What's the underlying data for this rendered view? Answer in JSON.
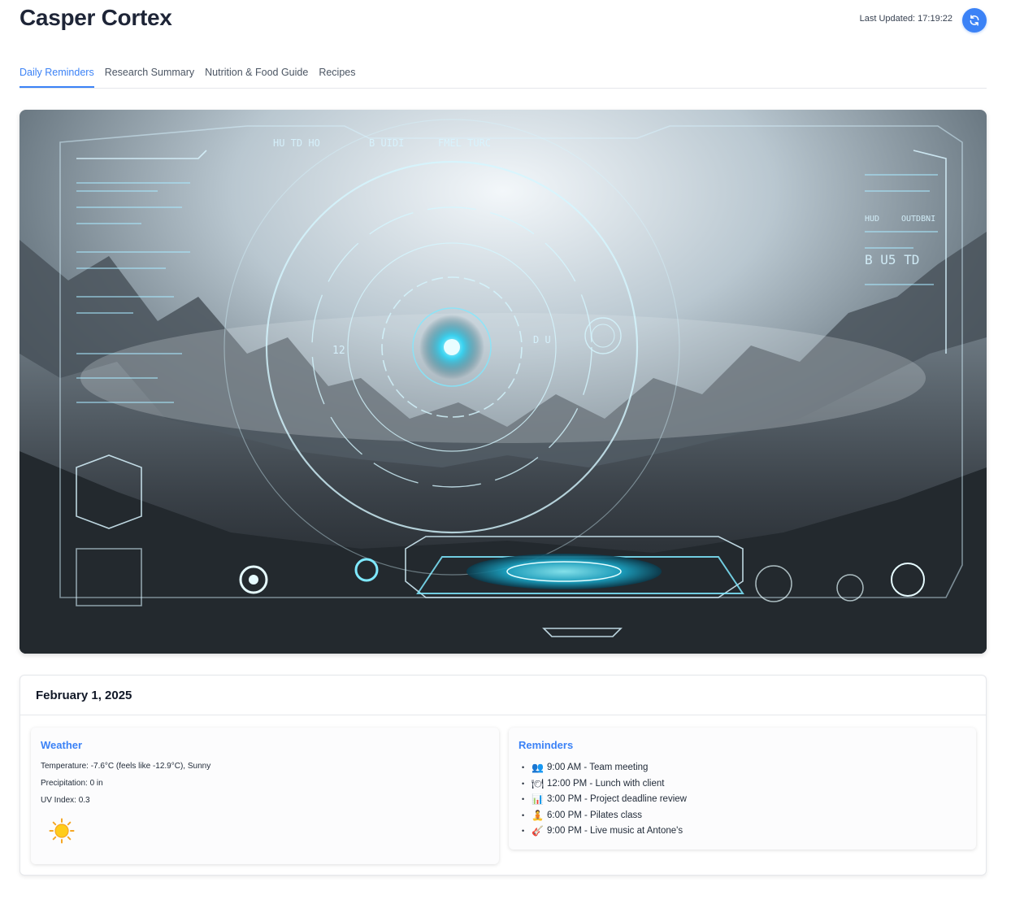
{
  "app": {
    "title": "Casper Cortex",
    "last_updated": "Last Updated: 17:19:22",
    "refresh_icon": "refresh-icon"
  },
  "tabs": [
    {
      "label": "Daily Reminders",
      "active": true
    },
    {
      "label": "Research Summary",
      "active": false
    },
    {
      "label": "Nutrition & Food Guide",
      "active": false
    },
    {
      "label": "Recipes",
      "active": false
    }
  ],
  "hero": {
    "hud_text_top": "HU TD HO",
    "hud_text_top2": "B UIDI",
    "hud_text_top3": "FMEL TURC",
    "hud_text_right1": "HUD",
    "hud_text_right2": "OUTDBNI",
    "hud_text_right3": "B U5 TD",
    "hud_text_left": "12",
    "hud_text_mid": "D U"
  },
  "day": {
    "date": "February 1, 2025",
    "weather": {
      "title": "Weather",
      "temperature": "Temperature: -7.6°C (feels like -12.9°C), Sunny",
      "precipitation": "Precipitation: 0 in",
      "uv_index": "UV Index: 0.3",
      "icon": "sun-icon"
    },
    "reminders": {
      "title": "Reminders",
      "items": [
        {
          "emoji": "👥",
          "text": "9:00 AM - Team meeting"
        },
        {
          "emoji": "🍽",
          "text": "12:00 PM - Lunch with client"
        },
        {
          "emoji": "📊",
          "text": "3:00 PM - Project deadline review"
        },
        {
          "emoji": "🧘",
          "text": "6:00 PM - Pilates class"
        },
        {
          "emoji": "🎸",
          "text": "9:00 PM - Live music at Antone's"
        }
      ]
    }
  },
  "colors": {
    "accent": "#3b82f6",
    "title": "#1e2537",
    "border": "#e5e7eb"
  }
}
